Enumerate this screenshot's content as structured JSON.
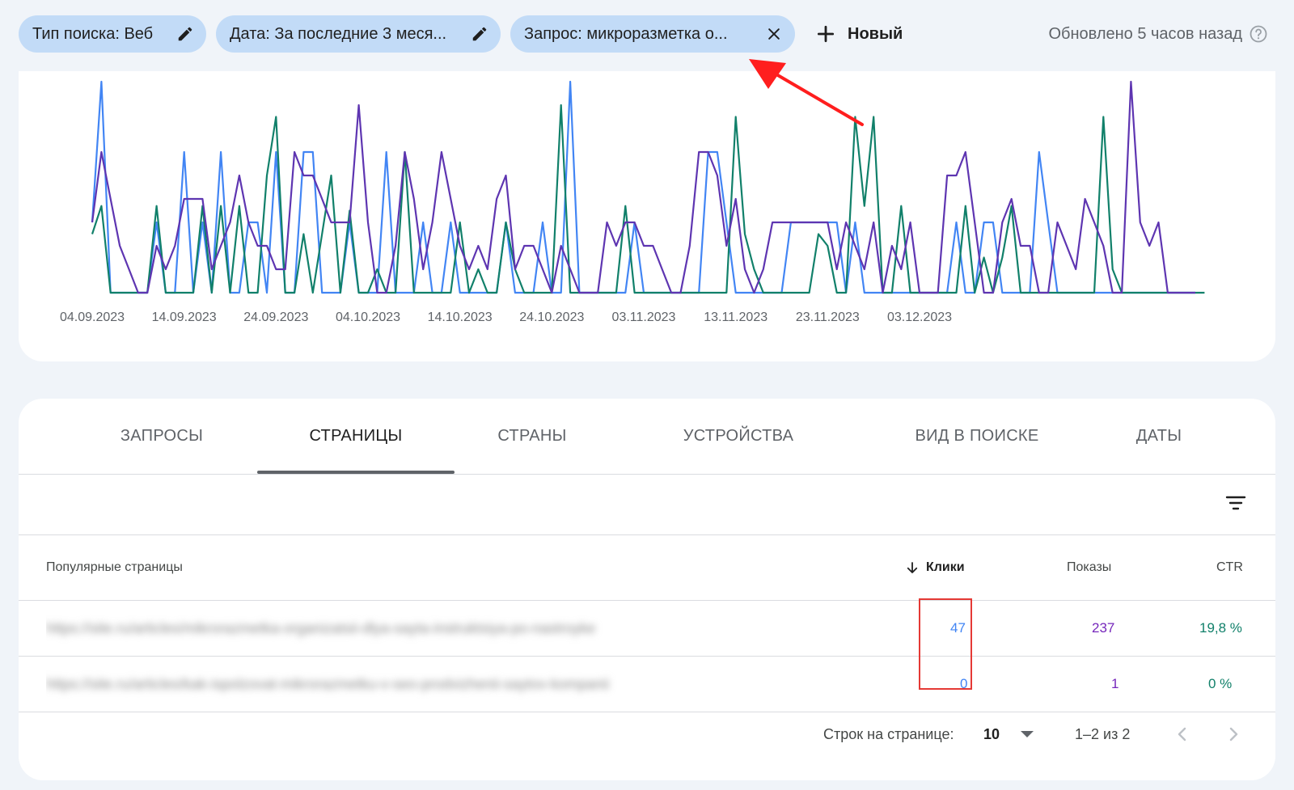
{
  "filters": {
    "chips": [
      {
        "label": "Тип поиска: Веб",
        "icon": "pencil-icon"
      },
      {
        "label": "Дата: За последние 3 меся...",
        "icon": "pencil-icon"
      },
      {
        "label": "Запрос: микроразметка о...",
        "icon": "close-icon"
      }
    ],
    "new_label": "Новый",
    "updated_text": "Обновлено 5 часов назад"
  },
  "chart_data": {
    "type": "line",
    "x_tick_labels": [
      "04.09.2023",
      "14.09.2023",
      "24.09.2023",
      "04.10.2023",
      "14.10.2023",
      "24.10.2023",
      "03.11.2023",
      "13.11.2023",
      "23.11.2023",
      "03.12.2023"
    ],
    "ylim": [
      0,
      9
    ],
    "grid": false,
    "legend": "none",
    "colors": {
      "clicks": "#4285f4",
      "impressions": "#5e35b1",
      "ctr": "#11806a"
    },
    "series": [
      {
        "values": [
          3,
          9,
          0,
          0,
          0,
          0,
          0,
          3,
          0,
          0,
          6,
          0,
          3,
          0,
          6,
          0,
          0,
          3,
          3,
          0,
          6,
          0,
          0,
          6,
          6,
          0,
          0,
          0,
          3,
          0,
          0,
          0,
          6,
          0,
          0,
          0,
          3,
          0,
          0,
          3,
          0,
          0,
          0,
          0,
          0,
          3,
          0,
          0,
          0,
          3,
          0,
          0,
          9,
          0,
          0,
          0,
          0,
          0,
          0,
          3,
          0,
          0,
          0,
          0,
          0,
          0,
          0,
          6,
          6,
          3,
          0,
          0,
          0,
          0,
          0,
          0,
          3,
          3,
          3,
          3,
          3,
          3,
          0,
          3,
          0,
          0,
          0,
          0,
          0,
          0,
          0,
          0,
          0,
          0,
          3,
          0,
          0,
          3,
          3,
          0,
          0,
          0,
          0,
          6,
          3,
          0,
          0,
          0,
          0,
          0,
          0,
          0,
          0,
          0,
          0,
          0,
          0,
          0,
          0,
          0,
          0
        ]
      },
      {
        "values": [
          2.5,
          3.7,
          0,
          0,
          0,
          0,
          0,
          3.7,
          0,
          0,
          0,
          0,
          3.7,
          0,
          3.7,
          0,
          3.7,
          0,
          0,
          5,
          7.5,
          0,
          0,
          2.5,
          0,
          2.5,
          5,
          0,
          3.5,
          0,
          0,
          1,
          0,
          0,
          6,
          0,
          0,
          0,
          0,
          0,
          3,
          0,
          1,
          0,
          0,
          3,
          1,
          0,
          0,
          0,
          0,
          8,
          0,
          0,
          0,
          0,
          0,
          0,
          3.7,
          0,
          0,
          0,
          0,
          0,
          0,
          0,
          0,
          0,
          0,
          0,
          7.5,
          2.5,
          1,
          0,
          0,
          0,
          0,
          0,
          0,
          2.5,
          2,
          0,
          0,
          7.5,
          3.7,
          7.5,
          0,
          0,
          3.7,
          0,
          0,
          0,
          0,
          0,
          0,
          3.7,
          0,
          1.5,
          0,
          1.5,
          3.7,
          0,
          0,
          0,
          0,
          0,
          0,
          0,
          0,
          0,
          7.5,
          1,
          0,
          0,
          0,
          0,
          0,
          0,
          0,
          0,
          0,
          0
        ]
      },
      {
        "values": [
          3,
          6,
          4,
          2,
          1,
          0,
          0,
          2,
          1,
          2,
          4,
          4,
          4,
          1,
          2,
          3,
          5,
          3,
          2,
          2,
          1,
          1,
          6,
          5,
          5,
          4,
          3,
          3,
          3,
          8,
          3,
          0,
          0,
          2,
          6,
          4,
          1,
          3,
          6,
          4,
          2,
          1,
          2,
          1,
          4,
          5,
          1,
          2,
          2,
          1,
          0,
          2,
          1,
          0,
          0,
          0,
          3,
          2,
          3,
          3,
          2,
          2,
          1,
          0,
          0,
          2,
          6,
          6,
          5,
          2,
          4,
          1,
          0,
          1,
          3,
          3,
          3,
          3,
          3,
          3,
          3,
          1,
          3,
          2,
          1,
          3,
          0,
          2,
          1,
          3,
          0,
          0,
          0,
          5,
          5,
          6,
          3,
          0,
          0,
          3,
          4,
          2,
          2,
          0,
          0,
          3,
          2,
          1,
          4,
          3,
          2,
          0,
          0,
          9,
          3,
          2,
          3,
          0,
          0,
          0,
          0
        ]
      }
    ]
  },
  "tabs": [
    "ЗАПРОСЫ",
    "СТРАНИЦЫ",
    "СТРАНЫ",
    "УСТРОЙСТВА",
    "ВИД В ПОИСКЕ",
    "ДАТЫ"
  ],
  "table": {
    "headers": {
      "page": "Популярные страницы",
      "clicks": "Клики",
      "impressions": "Показы",
      "ctr": "CTR"
    },
    "rows": [
      {
        "url": "https://site.ru/articles/mikrorazmetka-organizatsii-dlya-sayta-instruktsiya-po-nastroyke",
        "clicks": "47",
        "impressions": "237",
        "ctr": "19,8 %"
      },
      {
        "url": "https://site.ru/articles/kak-ispolzovat-mikrorazmetku-v-seo-prodvizhenii-saytov-kompanii",
        "clicks": "0",
        "impressions": "1",
        "ctr": "0 %"
      }
    ]
  },
  "pagination": {
    "rows_label": "Строк на странице:",
    "rows_value": "10",
    "range_text": "1–2 из 2"
  }
}
